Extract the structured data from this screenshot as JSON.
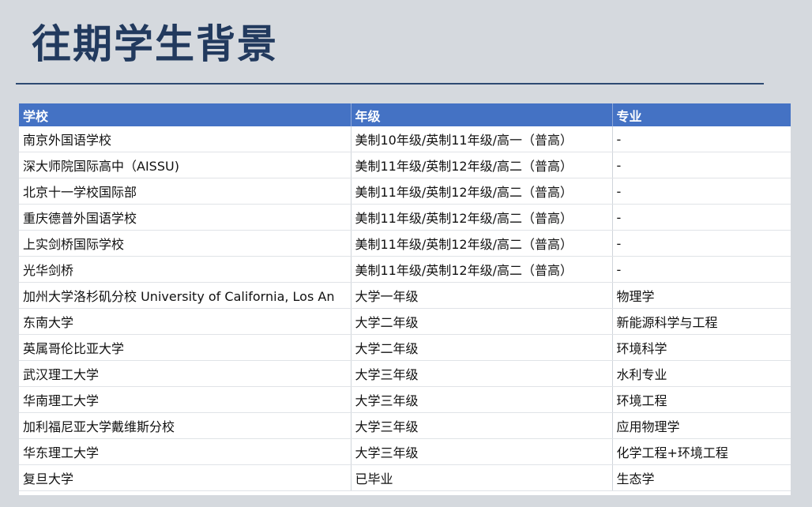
{
  "page": {
    "title": "往期学生背景"
  },
  "table": {
    "headers": [
      "学校",
      "年级",
      "专业"
    ],
    "rows": [
      [
        "南京外国语学校",
        "美制10年级/英制11年级/高一（普高）",
        "-"
      ],
      [
        "深大师院国际高中（AISSU)",
        "美制11年级/英制12年级/高二（普高）",
        "-"
      ],
      [
        "北京十一学校国际部",
        "美制11年级/英制12年级/高二（普高）",
        "-"
      ],
      [
        "重庆德普外国语学校",
        "美制11年级/英制12年级/高二（普高）",
        "-"
      ],
      [
        "上实剑桥国际学校",
        "美制11年级/英制12年级/高二（普高）",
        "-"
      ],
      [
        "光华剑桥",
        "美制11年级/英制12年级/高二（普高）",
        "-"
      ],
      [
        "加州大学洛杉矶分校 University of California, Los An",
        "大学一年级",
        "物理学"
      ],
      [
        "东南大学",
        "大学二年级",
        "新能源科学与工程"
      ],
      [
        "英属哥伦比亚大学",
        "大学二年级",
        "环境科学"
      ],
      [
        "武汉理工大学",
        "大学三年级",
        "水利专业"
      ],
      [
        "华南理工大学",
        "大学三年级",
        "环境工程"
      ],
      [
        "加利福尼亚大学戴维斯分校",
        "大学三年级",
        "应用物理学"
      ],
      [
        "华东理工大学",
        "大学三年级",
        "化学工程+环境工程"
      ],
      [
        "复旦大学",
        "已毕业",
        "生态学"
      ]
    ]
  },
  "colors": {
    "background": "#d5d9de",
    "title": "#223a5e",
    "header_fill": "#4472c4",
    "rule": "#2e4a72"
  }
}
